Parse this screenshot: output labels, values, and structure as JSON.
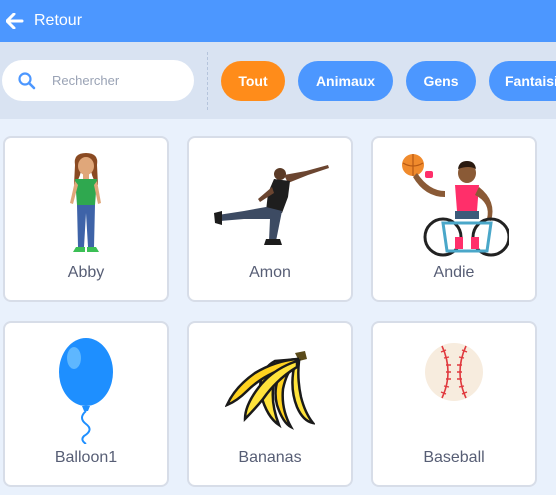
{
  "header": {
    "back_label": "Retour"
  },
  "search": {
    "placeholder": "Rechercher"
  },
  "tags": [
    {
      "label": "Tout",
      "active": true
    },
    {
      "label": "Animaux",
      "active": false
    },
    {
      "label": "Gens",
      "active": false
    },
    {
      "label": "Fantaisie",
      "active": false
    }
  ],
  "sprites": [
    {
      "name": "Abby",
      "icon": "girl-character-icon"
    },
    {
      "name": "Amon",
      "icon": "dancing-man-icon"
    },
    {
      "name": "Andie",
      "icon": "wheelchair-basketball-player-icon"
    },
    {
      "name": "Balloon1",
      "icon": "blue-balloon-icon"
    },
    {
      "name": "Bananas",
      "icon": "banana-bunch-icon"
    },
    {
      "name": "Baseball",
      "icon": "baseball-icon"
    }
  ],
  "colors": {
    "header": "#4c97ff",
    "active_tag": "#ff8c1a",
    "tag": "#4c97ff",
    "filter_bar": "#d9e3f2",
    "background": "#e9f1fc"
  }
}
